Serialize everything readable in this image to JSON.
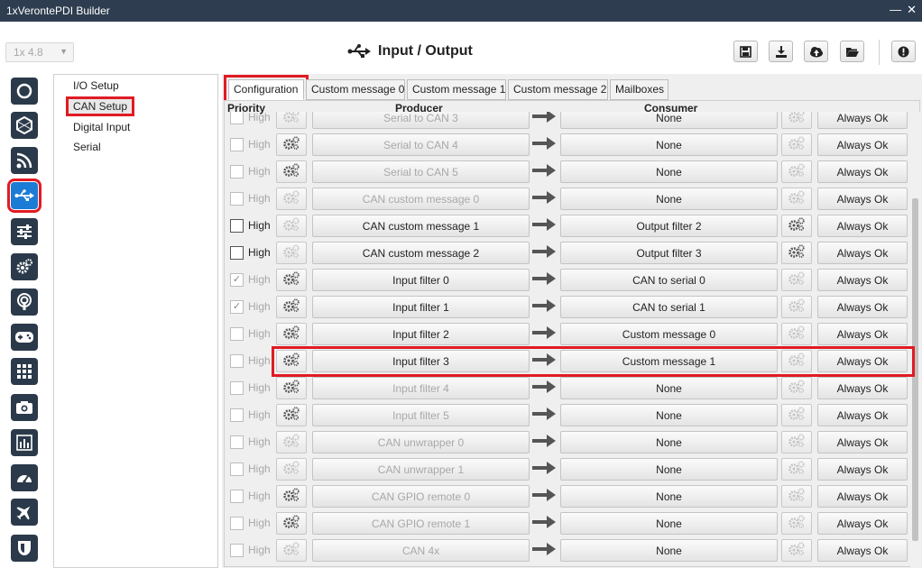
{
  "window": {
    "title": "1xVerontePDI Builder",
    "minimize": "—",
    "close": "✕"
  },
  "toolbar": {
    "version": "1x 4.8",
    "page_title": "Input / Output"
  },
  "tree": {
    "items": [
      "I/O Setup",
      "CAN Setup",
      "Digital Input",
      "Serial"
    ]
  },
  "tabs": [
    "Configuration",
    "Custom message 0",
    "Custom message 1",
    "Custom message 2",
    "Mailboxes"
  ],
  "headers": {
    "priority": "Priority",
    "producer": "Producer",
    "consumer": "Consumer"
  },
  "rows": [
    {
      "high": "High",
      "producer": "Serial to CAN 3",
      "consumer": "None",
      "status": "Always Ok"
    },
    {
      "high": "High",
      "producer": "Serial to CAN 4",
      "consumer": "None",
      "status": "Always Ok"
    },
    {
      "high": "High",
      "producer": "Serial to CAN 5",
      "consumer": "None",
      "status": "Always Ok"
    },
    {
      "high": "High",
      "producer": "CAN custom message 0",
      "consumer": "None",
      "status": "Always Ok"
    },
    {
      "high": "High",
      "producer": "CAN custom message 1",
      "consumer": "Output filter 2",
      "status": "Always Ok"
    },
    {
      "high": "High",
      "producer": "CAN custom message 2",
      "consumer": "Output filter 3",
      "status": "Always Ok"
    },
    {
      "high": "High",
      "producer": "Input filter 0",
      "consumer": "CAN to serial 0",
      "status": "Always Ok"
    },
    {
      "high": "High",
      "producer": "Input filter 1",
      "consumer": "CAN to serial 1",
      "status": "Always Ok"
    },
    {
      "high": "High",
      "producer": "Input filter 2",
      "consumer": "Custom message 0",
      "status": "Always Ok"
    },
    {
      "high": "High",
      "producer": "Input filter 3",
      "consumer": "Custom message 1",
      "status": "Always Ok"
    },
    {
      "high": "High",
      "producer": "Input filter 4",
      "consumer": "None",
      "status": "Always Ok"
    },
    {
      "high": "High",
      "producer": "Input filter 5",
      "consumer": "None",
      "status": "Always Ok"
    },
    {
      "high": "High",
      "producer": "CAN unwrapper 0",
      "consumer": "None",
      "status": "Always Ok"
    },
    {
      "high": "High",
      "producer": "CAN unwrapper 1",
      "consumer": "None",
      "status": "Always Ok"
    },
    {
      "high": "High",
      "producer": "CAN GPIO remote 0",
      "consumer": "None",
      "status": "Always Ok"
    },
    {
      "high": "High",
      "producer": "CAN GPIO remote 1",
      "consumer": "None",
      "status": "Always Ok"
    },
    {
      "high": "High",
      "producer": "CAN 4x",
      "consumer": "None",
      "status": "Always Ok"
    }
  ],
  "colors": {
    "titlebar": "#2e3d4f",
    "nav_button": "#2b3a4a",
    "nav_active": "#1c7bd4",
    "highlight": "#e01b24"
  }
}
